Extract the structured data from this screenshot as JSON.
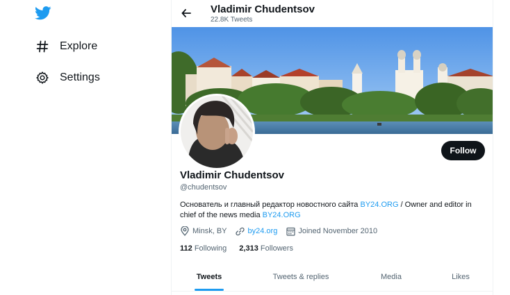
{
  "nav": {
    "logo_icon": "twitter-bird-icon",
    "items": [
      {
        "label": "Explore",
        "icon": "hashtag-icon"
      },
      {
        "label": "Settings",
        "icon": "gear-icon"
      }
    ]
  },
  "header": {
    "name": "Vladimir Chudentsov",
    "tweet_count": "22.8K Tweets",
    "back_icon": "arrow-left-icon"
  },
  "profile": {
    "name": "Vladimir Chudentsov",
    "handle": "@chudentsov",
    "follow_label": "Follow",
    "bio_text_1": "Основатель и главный редактор новостного сайта ",
    "bio_link_1": "BY24.ORG",
    "bio_text_2": " / Owner and editor in chief of the news media ",
    "bio_link_2": "BY24.ORG",
    "location": "Minsk, BY",
    "website": "by24.org",
    "joined": "Joined November 2010",
    "following_count": "112",
    "following_label": "Following",
    "followers_count": "2,313",
    "followers_label": "Followers"
  },
  "tabs": [
    {
      "label": "Tweets",
      "active": true
    },
    {
      "label": "Tweets & replies",
      "active": false
    },
    {
      "label": "Media",
      "active": false
    },
    {
      "label": "Likes",
      "active": false
    }
  ],
  "colors": {
    "accent": "#1d9bf0",
    "text": "#0f1419",
    "muted": "#536471",
    "follow_bg": "#0f1419"
  }
}
